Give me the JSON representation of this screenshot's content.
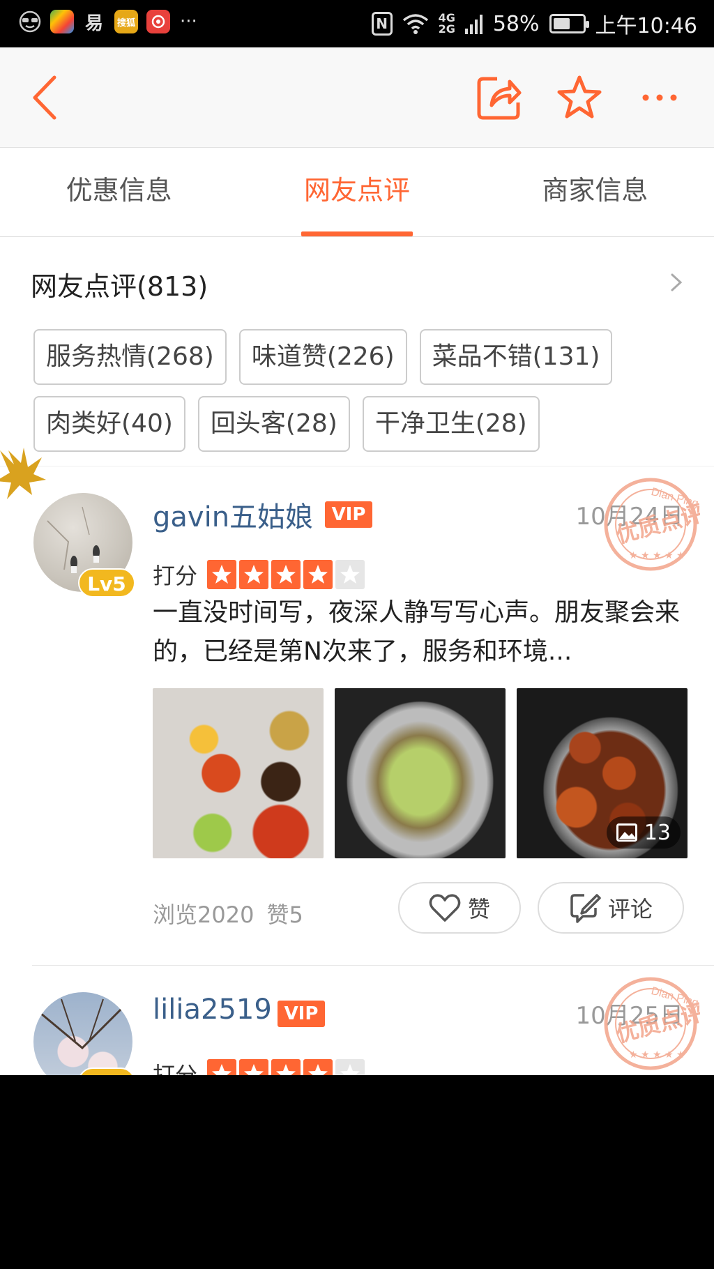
{
  "status_bar": {
    "apps": [
      {
        "name": "glasses-app-icon",
        "color": "#888"
      },
      {
        "name": "maps-app-icon",
        "color": "#4caf50"
      },
      {
        "name": "yi-app-icon",
        "color": "#000",
        "label": "易"
      },
      {
        "name": "sohu-app-icon",
        "color": "#e6a817",
        "label": "搜狐"
      },
      {
        "name": "weibo-app-icon",
        "color": "#e8413c"
      }
    ],
    "more": "···",
    "network": "4G",
    "network2": "2G",
    "battery": "58%",
    "battery_level": 0.58,
    "time": "上午10:46"
  },
  "navbar": {
    "accent": "#ff6633"
  },
  "tabs": [
    {
      "label": "优惠信息",
      "active": false
    },
    {
      "label": "网友点评",
      "active": true
    },
    {
      "label": "商家信息",
      "active": false
    }
  ],
  "section": {
    "title": "网友点评(813)"
  },
  "tags": [
    "服务热情(268)",
    "味道赞(226)",
    "菜品不错(131)",
    "肉类好(40)",
    "回头客(28)",
    "干净卫生(28)"
  ],
  "reviews": [
    {
      "username": "gavin五姑娘",
      "vip": "VIP",
      "level": "Lv5",
      "date": "10月24日",
      "rating_label": "打分",
      "rating": 4,
      "rating_max": 5,
      "text": "一直没时间写，夜深人静写写心声。朋友聚会来的，已经是第N次来了，服务和环境...",
      "photo_count": "13",
      "views": "浏览2020",
      "likes": "赞5",
      "like_button": "赞",
      "comment_button": "评论"
    },
    {
      "username": "lilia2519",
      "vip": "VIP",
      "date": "10月25日",
      "rating_label": "打分",
      "rating": 4,
      "rating_max": 5
    }
  ]
}
